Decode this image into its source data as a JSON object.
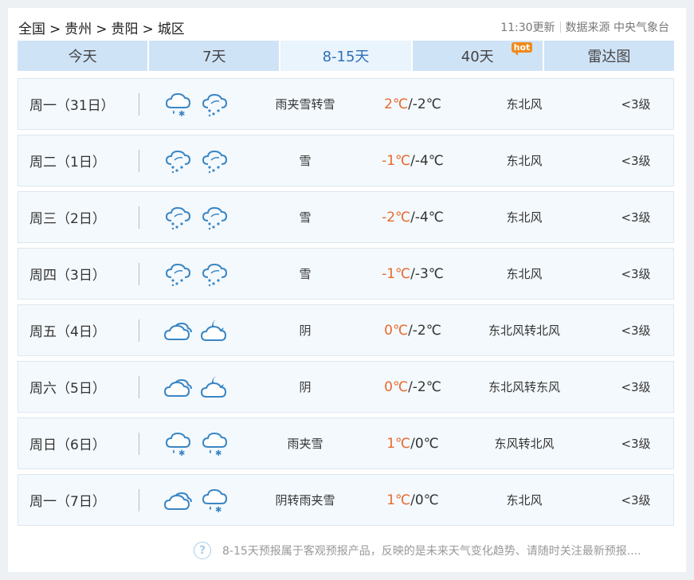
{
  "breadcrumb": {
    "country": "全国",
    "province": "贵州",
    "city": "贵阳",
    "district": "城区",
    "separator": ">"
  },
  "source": {
    "updated": "11:30更新",
    "label": "数据来源 中央气象台"
  },
  "tabs": [
    {
      "label": "今天",
      "active": false
    },
    {
      "label": "7天",
      "active": false
    },
    {
      "label": "8-15天",
      "active": true
    },
    {
      "label": "40天",
      "active": false,
      "badge": "hot"
    },
    {
      "label": "雷达图",
      "active": false
    }
  ],
  "forecast": [
    {
      "day": "周一（31日）",
      "icons": [
        "rain-snow-icon",
        "snow-icon"
      ],
      "weather": "雨夹雪转雪",
      "high": "2℃",
      "low": "/-2℃",
      "wind": "东北风",
      "level": "<3级"
    },
    {
      "day": "周二（1日）",
      "icons": [
        "snow-icon",
        "snow-icon"
      ],
      "weather": "雪",
      "high": "-1℃",
      "low": "/-4℃",
      "wind": "东北风",
      "level": "<3级"
    },
    {
      "day": "周三（2日）",
      "icons": [
        "snow-icon",
        "snow-icon"
      ],
      "weather": "雪",
      "high": "-2℃",
      "low": "/-4℃",
      "wind": "东北风",
      "level": "<3级"
    },
    {
      "day": "周四（3日）",
      "icons": [
        "snow-icon",
        "snow-icon"
      ],
      "weather": "雪",
      "high": "-1℃",
      "low": "/-3℃",
      "wind": "东北风",
      "level": "<3级"
    },
    {
      "day": "周五（4日）",
      "icons": [
        "overcast-icon",
        "cloudy-night-icon"
      ],
      "weather": "阴",
      "high": "0℃",
      "low": "/-2℃",
      "wind": "东北风转北风",
      "level": "<3级"
    },
    {
      "day": "周六（5日）",
      "icons": [
        "overcast-icon",
        "cloudy-night-icon"
      ],
      "weather": "阴",
      "high": "0℃",
      "low": "/-2℃",
      "wind": "东北风转东风",
      "level": "<3级"
    },
    {
      "day": "周日（6日）",
      "icons": [
        "rain-snow-icon",
        "rain-snow-icon"
      ],
      "weather": "雨夹雪",
      "high": "1℃",
      "low": "/0℃",
      "wind": "东风转北风",
      "level": "<3级"
    },
    {
      "day": "周一（7日）",
      "icons": [
        "overcast-icon",
        "rain-snow-icon"
      ],
      "weather": "阴转雨夹雪",
      "high": "1℃",
      "low": "/0℃",
      "wind": "东北风",
      "level": "<3级"
    }
  ],
  "footer": {
    "icon": "question-icon",
    "text": "8-15天预报属于客观预报产品，反映的是未来天气变化趋势、请随时关注最新预报....",
    "mark": "?"
  },
  "colors": {
    "tab_bg": "#cfe3f7",
    "tab_active_bg": "#eaf4fd",
    "tab_active_text": "#2d6fb7",
    "high_temp": "#e8692c",
    "hot_badge": "#f08a1c",
    "icon_stroke": "#3a86c4"
  }
}
